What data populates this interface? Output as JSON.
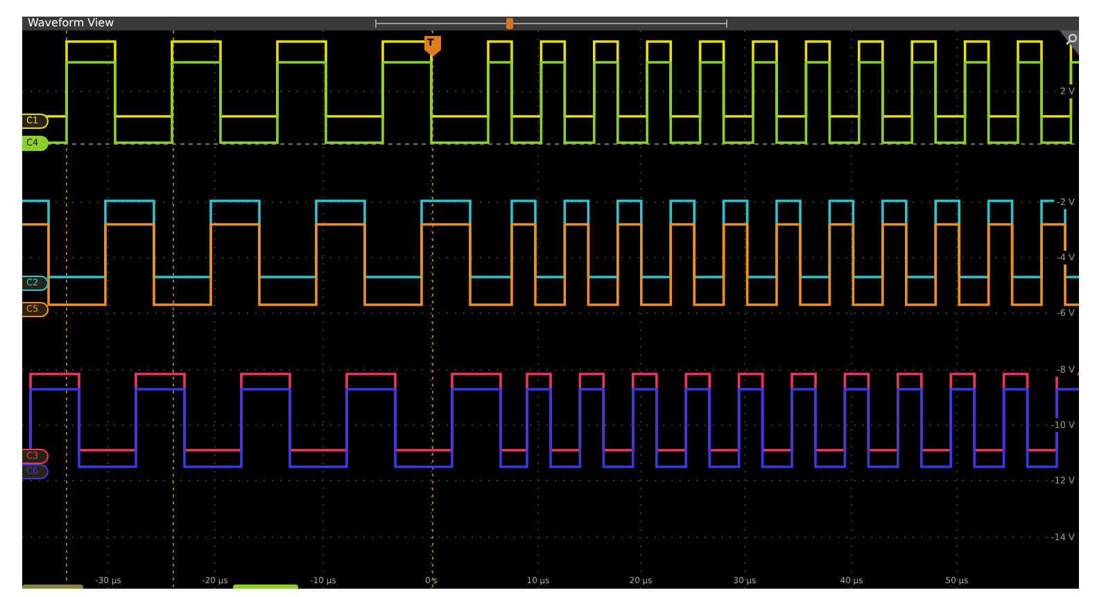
{
  "window": {
    "title": "Waveform View"
  },
  "channels": [
    {
      "label": "C1",
      "color": "#e8e000",
      "selected": false
    },
    {
      "label": "C4",
      "color": "#8cd12a",
      "selected": true
    },
    {
      "label": "C2",
      "color": "#2ec4d0",
      "selected": false
    },
    {
      "label": "C5",
      "color": "#f0901a",
      "selected": false
    },
    {
      "label": "C3",
      "color": "#f0365a",
      "selected": false
    },
    {
      "label": "C6",
      "color": "#3a3ae0",
      "selected": false
    }
  ],
  "trigger": {
    "label": "T"
  },
  "y_axis_labels": [
    "2 V",
    "-2 V",
    "-4 V",
    "-6 V",
    "-8 V",
    "-10 V",
    "-12 V",
    "-14 V"
  ],
  "time_axis_labels": [
    "-30 µs",
    "-20 µs",
    "-10 µs",
    "0 s",
    "10 µs",
    "20 µs",
    "30 µs",
    "40 µs",
    "50 µs"
  ]
}
